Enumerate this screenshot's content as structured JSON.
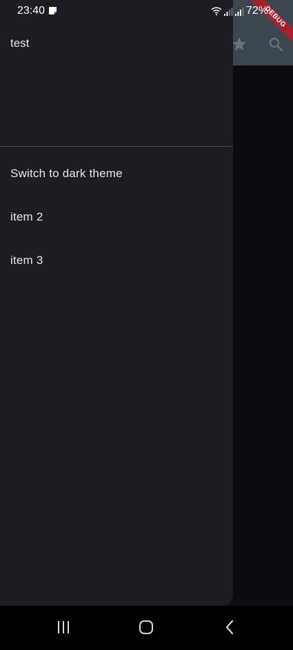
{
  "status_bar": {
    "time": "23:40",
    "battery": "72%"
  },
  "app_bar": {
    "actions": [
      "star-icon",
      "search-icon"
    ]
  },
  "debug_banner": {
    "label": "DEBUG",
    "color": "#a8202c"
  },
  "drawer": {
    "header_title": "test",
    "items": [
      {
        "label": "Switch to dark theme"
      },
      {
        "label": "item 2"
      },
      {
        "label": "item 3"
      }
    ]
  },
  "nav_bar": {
    "buttons": [
      "recent-apps-icon",
      "home-icon",
      "back-icon"
    ]
  }
}
